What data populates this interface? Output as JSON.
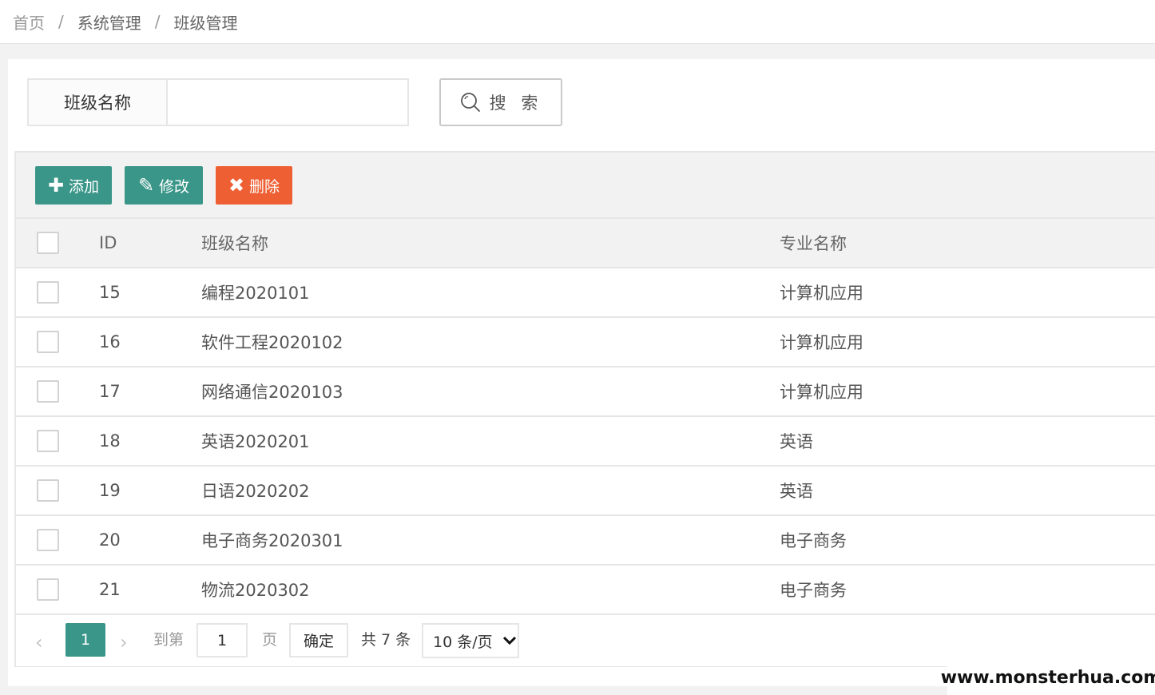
{
  "breadcrumb": {
    "items": [
      "首页",
      "系统管理",
      "班级管理"
    ],
    "separator": "/"
  },
  "search": {
    "label": "班级名称",
    "value": "",
    "placeholder": "",
    "button_label": "搜 索",
    "button_icon": "search-icon"
  },
  "toolbar": {
    "add_label": "添加",
    "add_icon": "plus-icon",
    "edit_label": "修改",
    "edit_icon": "pencil-icon",
    "delete_label": "删除",
    "delete_icon": "close-icon"
  },
  "table": {
    "headers": [
      "ID",
      "班级名称",
      "专业名称"
    ],
    "rows": [
      {
        "id": "15",
        "name": "编程2020101",
        "major": "计算机应用"
      },
      {
        "id": "16",
        "name": "软件工程2020102",
        "major": "计算机应用"
      },
      {
        "id": "17",
        "name": "网络通信2020103",
        "major": "计算机应用"
      },
      {
        "id": "18",
        "name": "英语2020201",
        "major": "英语"
      },
      {
        "id": "19",
        "name": "日语2020202",
        "major": "英语"
      },
      {
        "id": "20",
        "name": "电子商务2020301",
        "major": "电子商务"
      },
      {
        "id": "21",
        "name": "物流2020302",
        "major": "电子商务"
      }
    ]
  },
  "pager": {
    "current_page": "1",
    "goto_label": "到第",
    "goto_value": "1",
    "page_label": "页",
    "confirm_label": "确定",
    "total_label": "共 7 条",
    "page_size": "10 条/页"
  },
  "watermark": "www.monsterhua.com",
  "colors": {
    "primary": "#3a9688",
    "danger": "#ee5f33"
  }
}
